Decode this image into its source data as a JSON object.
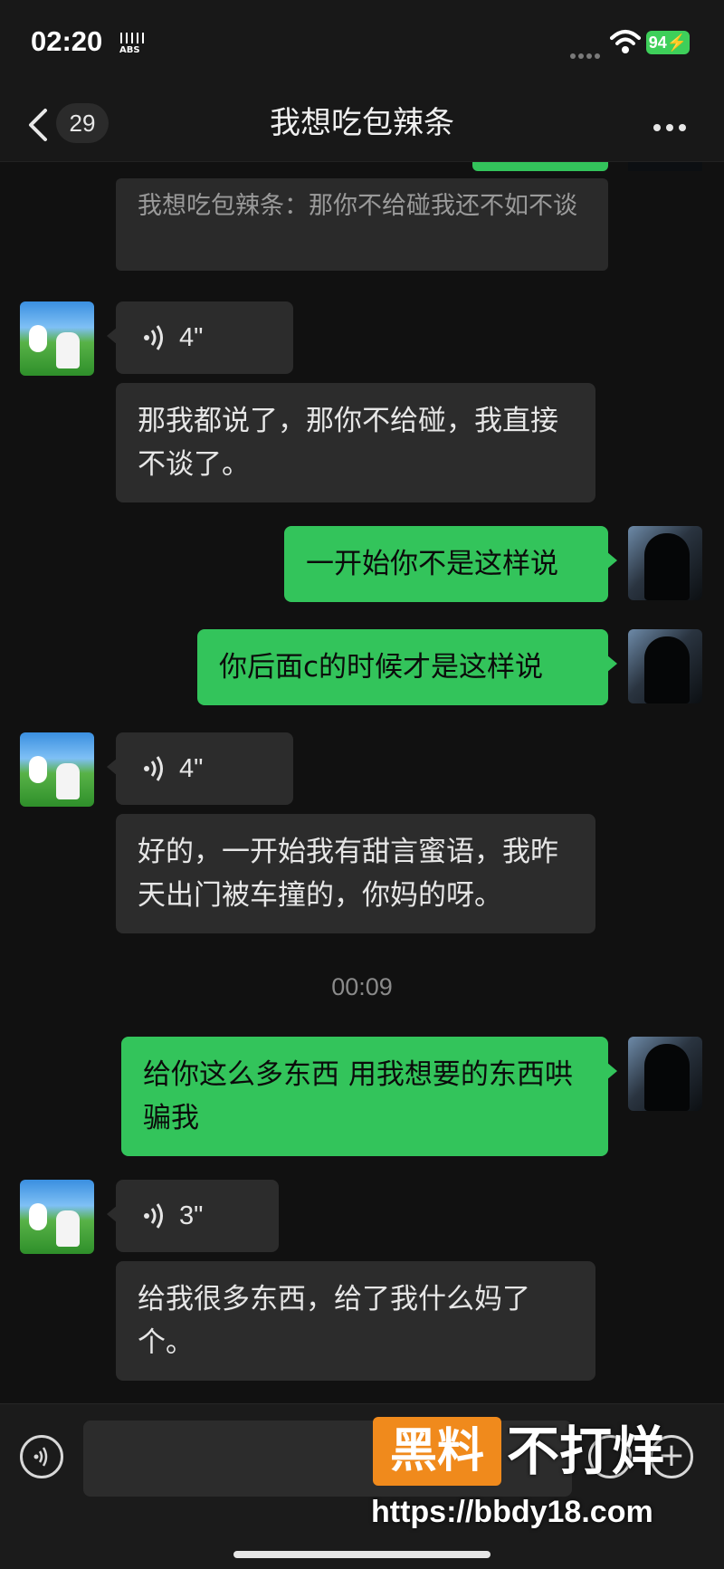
{
  "status_bar": {
    "time": "02:20",
    "abs_label": "ABS",
    "battery": "94"
  },
  "header": {
    "back_count": "29",
    "title": "我想吃包辣条"
  },
  "quote": {
    "text": "我想吃包辣条：那你不给碰我还不如不谈"
  },
  "messages": [
    {
      "side": "in",
      "type": "voice",
      "duration": "4\""
    },
    {
      "side": "in",
      "type": "text",
      "text": "那我都说了，那你不给碰，我直接不谈了。"
    },
    {
      "side": "out",
      "type": "text",
      "text": "一开始你不是这样说"
    },
    {
      "side": "out",
      "type": "text",
      "text": "你后面c的时候才是这样说"
    },
    {
      "side": "in",
      "type": "voice",
      "duration": "4\""
    },
    {
      "side": "in",
      "type": "text",
      "text": "好的，一开始我有甜言蜜语，我昨天出门被车撞的，你妈的呀。"
    },
    {
      "side": "out",
      "type": "text",
      "text": "给你这么多东西 用我想要的东西哄骗我"
    },
    {
      "side": "in",
      "type": "voice",
      "duration": "3\""
    },
    {
      "side": "in",
      "type": "text",
      "text": "给我很多东西，给了我什么妈了个。"
    }
  ],
  "timestamp": "00:09",
  "watermark": {
    "box_text": "黑料",
    "text": "不打烊",
    "url": "https://bbdy18.com"
  },
  "colors": {
    "background": "#111111",
    "incoming_bubble": "#2c2c2c",
    "outgoing_bubble": "#33c45b",
    "battery": "#3ecf5a",
    "watermark_orange": "#f08a1c"
  }
}
